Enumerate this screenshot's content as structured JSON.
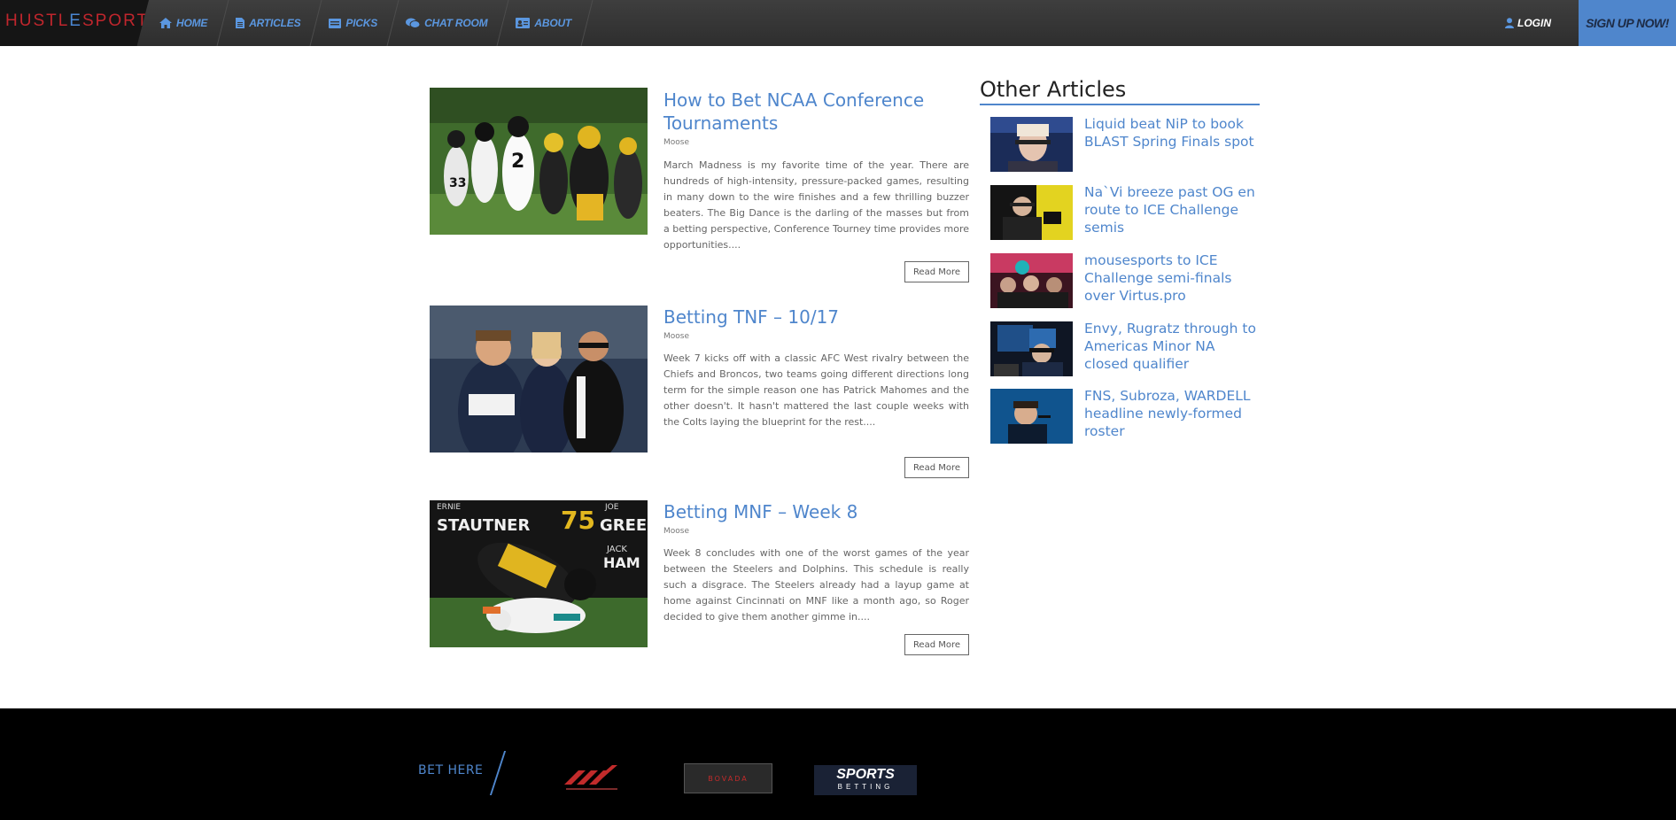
{
  "brand": {
    "part1": "HUSTL",
    "part2": "E",
    "part3": "SPORTS"
  },
  "nav": {
    "items": [
      {
        "label": "HOME",
        "icon": "home-icon"
      },
      {
        "label": "ARTICLES",
        "icon": "document-icon"
      },
      {
        "label": "PICKS",
        "icon": "ticket-icon"
      },
      {
        "label": "CHAT ROOM",
        "icon": "chat-icon"
      },
      {
        "label": "ABOUT",
        "icon": "id-card-icon"
      }
    ],
    "login": "LOGIN",
    "signup": "SIGN UP NOW!"
  },
  "articles": [
    {
      "title": "How to Bet NCAA Conference Tournaments",
      "author": "Moose",
      "excerpt": "March Madness is my favorite time of the year. There are hundreds of high-intensity, pressure-packed games, resulting in many down to the wire finishes and a few thrilling buzzer beaters. The Big Dance is the darling of the masses but from a betting perspective, Conference Tourney time provides more opportunities....",
      "read_more": "Read More"
    },
    {
      "title": "Betting TNF – 10/17",
      "author": "Moose",
      "excerpt": "Week 7 kicks off with a classic AFC West rivalry between the Chiefs and Broncos, two teams going different directions long term for the simple reason one has Patrick Mahomes and the other doesn't. It hasn't mattered the last couple weeks with the Colts laying the blueprint for the rest....",
      "read_more": "Read More"
    },
    {
      "title": "Betting MNF – Week 8",
      "author": "Moose",
      "excerpt": "Week 8 concludes with one of the worst games of the year between the Steelers and Dolphins. This schedule is really such a disgrace. The Steelers already had a layup game at home against Cincinnati on MNF like a month ago, so Roger decided to give them another gimme in....",
      "read_more": "Read More",
      "image_text": {
        "left": "ERNIE",
        "left2": "STAUTNER",
        "number": "75",
        "right": "JOE",
        "right2": "GREE",
        "right3": "JACK",
        "right4": "HAM"
      }
    }
  ],
  "sidebar": {
    "heading": "Other Articles",
    "items": [
      {
        "title": "Liquid beat NiP to book BLAST Spring Finals spot"
      },
      {
        "title": "Na`Vi breeze past OG en route to ICE Challenge semis"
      },
      {
        "title": "mousesports to ICE Challenge semi-finals over Virtus.pro"
      },
      {
        "title": "Envy, Rugratz through to Americas Minor NA closed qualifier"
      },
      {
        "title": "FNS, Subroza, WARDELL headline newly-formed roster"
      }
    ]
  },
  "footer": {
    "bet_here": "BET HERE",
    "logos": [
      {
        "name": "sportsbook-logo",
        "text": ""
      },
      {
        "name": "bovada-logo",
        "text": "BOVADA"
      },
      {
        "name": "sportsbetting-logo",
        "text1": "SPORTS",
        "text2": "BETTING"
      }
    ]
  },
  "colors": {
    "accent": "#4f86cc",
    "brand_red": "#c0262d",
    "nav_bg": "#353535",
    "footer_bg": "#000000"
  }
}
